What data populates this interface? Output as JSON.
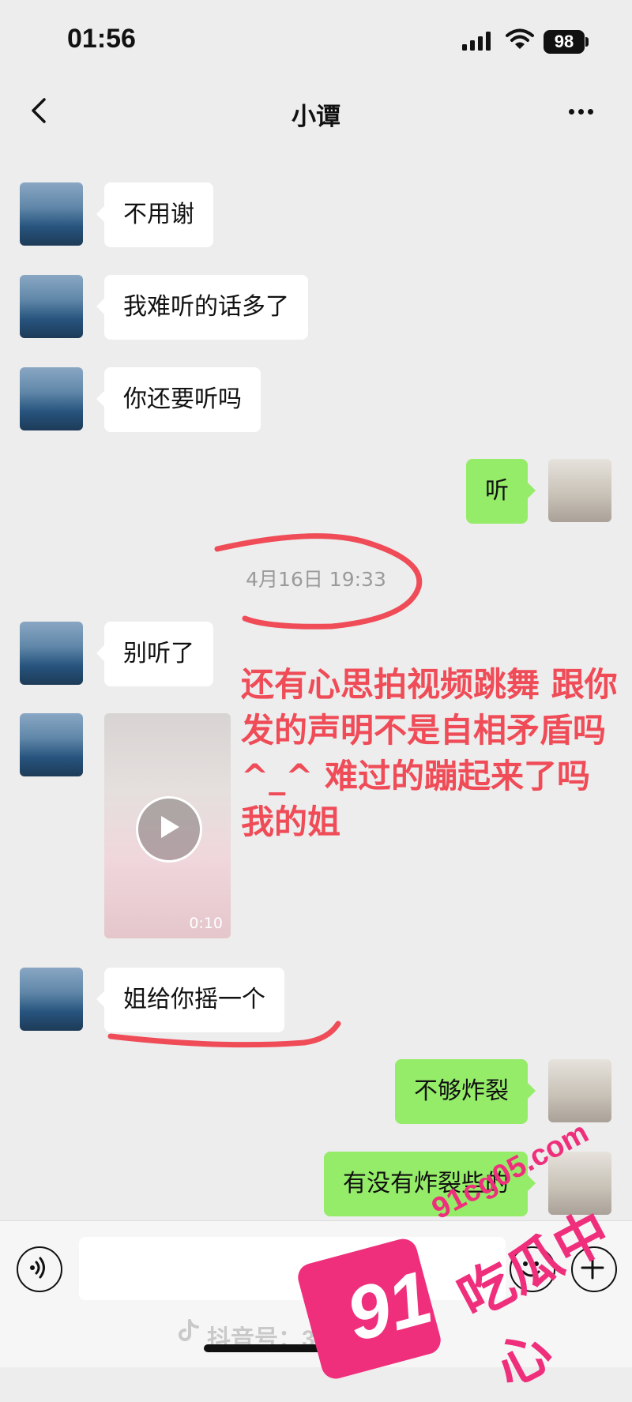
{
  "status": {
    "time": "01:56",
    "battery": "98"
  },
  "header": {
    "title": "小谭"
  },
  "messages": {
    "m1": "不用谢",
    "m2": "我难听的话多了",
    "m3": "你还要听吗",
    "m4": "听",
    "timestamp": "4月16日 19:33",
    "m5": "别听了",
    "video_duration": "0:10",
    "m6": "姐给你摇一个",
    "m7": "不够炸裂",
    "m8": "有没有炸裂些的"
  },
  "annotation": "还有心思拍视频跳舞 跟你发的声明不是自相矛盾吗^_^ 难过的蹦起来了吗 我的姐",
  "footer": {
    "douyin_id": "抖音号：3180238787"
  },
  "watermark": {
    "number": "91",
    "domain": "91cg05.com",
    "name": "吃瓜中心"
  },
  "colors": {
    "annotation_red": "#ef4c58",
    "outgoing_bubble": "#95ec69",
    "watermark_pink": "#ef2f7c"
  },
  "icons": [
    "back-chevron-icon",
    "more-dots-icon",
    "voice-icon",
    "emoji-icon",
    "plus-icon",
    "play-icon",
    "douyin-logo-icon",
    "wifi-icon",
    "signal-icon"
  ]
}
